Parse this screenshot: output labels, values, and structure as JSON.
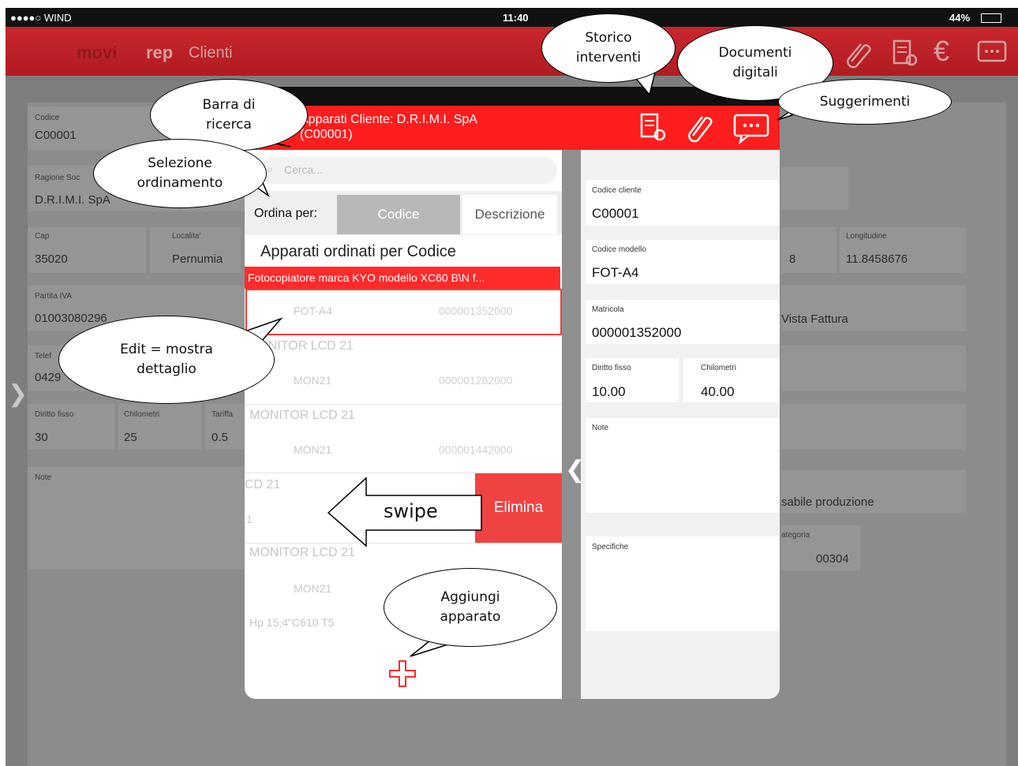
{
  "status_bar": {
    "carrier": "●●●●○ WIND",
    "time": "11:40",
    "battery": "44%"
  },
  "app_header": {
    "logo_part1": "movi",
    "logo_part2": "rep",
    "section": "Clienti"
  },
  "background_form": {
    "codice_label": "Codice",
    "codice_value": "C00001",
    "ragione_label": "Ragione Soc",
    "ragione_value": "D.R.I.M.I. SpA",
    "cap_label": "Cap",
    "cap_value": "35020",
    "localita_label": "Localita'",
    "localita_value": "Pernumia",
    "longitudine_label": "Longitudine",
    "longitudine_value": "11.8458676",
    "lat_partial": "8",
    "piva_label": "Partita IVA",
    "piva_value": "01003080296",
    "vista_value": "Vista Fattura",
    "tel_label": "Telef",
    "tel_value": "0429",
    "diritto_label": "Diritto fisso",
    "diritto_value": "30",
    "km_label": "Chilometri",
    "km_value": "25",
    "tariffa_label": "Tariffa",
    "tariffa_value": "0.5",
    "note_label": "Note",
    "produzione_value": "sabile produzione",
    "categoria_label": "ategoria",
    "categoria_value": "00304"
  },
  "modal": {
    "title_line1": "Apparati Cliente: D.R.I.M.I. SpA",
    "title_line2": "(C00001)",
    "search_placeholder": "Cerca...",
    "sort_label": "Ordina per:",
    "sort_options": [
      "Codice",
      "Descrizione"
    ],
    "list_header": "Apparati ordinati per Codice",
    "items": [
      {
        "group": "Fotocopiatore marca KYO modello XC60 B\\N f...",
        "code": "FOT-A4",
        "serial": "000001352000"
      },
      {
        "group": "MONITOR LCD 21",
        "code": "MON21",
        "serial": "000001282000"
      },
      {
        "group": "MONITOR LCD 21",
        "code": "MON21",
        "serial": "000001442000"
      },
      {
        "group": "CD 21",
        "code": "1",
        "serial": ""
      },
      {
        "group": "MONITOR LCD 21",
        "code": "MON21",
        "serial": ""
      },
      {
        "group": "Hp 15,4\"C610 T5",
        "code": "",
        "serial": ""
      }
    ],
    "delete_label": "Elimina",
    "detail": {
      "codice_cliente_label": "Codice cliente",
      "codice_cliente_value": "C00001",
      "codice_modello_label": "Codice modello",
      "codice_modello_value": "FOT-A4",
      "matricola_label": "Matricola",
      "matricola_value": "000001352000",
      "diritto_label": "Diritto fisso",
      "diritto_value": "10.00",
      "km_label": "Chilometri",
      "km_value": "40.00",
      "note_label": "Note",
      "specifiche_label": "Specifiche"
    }
  },
  "annotations": {
    "storico": "Storico interventi",
    "documenti": "Documenti digitali",
    "suggerimenti": "Suggerimenti",
    "barra": "Barra di ricerca",
    "selezione": "Selezione ordinamento",
    "edit": "Edit = mostra dettaglio",
    "aggiungi": "Aggiungi apparato",
    "swipe": "swipe"
  },
  "icons": [
    "document-search-icon",
    "paperclip-icon",
    "euro-icon",
    "chat-icon",
    "add-icon",
    "chevron-left-icon",
    "chevron-right-icon"
  ],
  "colors": {
    "brand_red": "#ff1d1d",
    "header_red": "#b01c22",
    "delete_red": "#ef4343"
  }
}
